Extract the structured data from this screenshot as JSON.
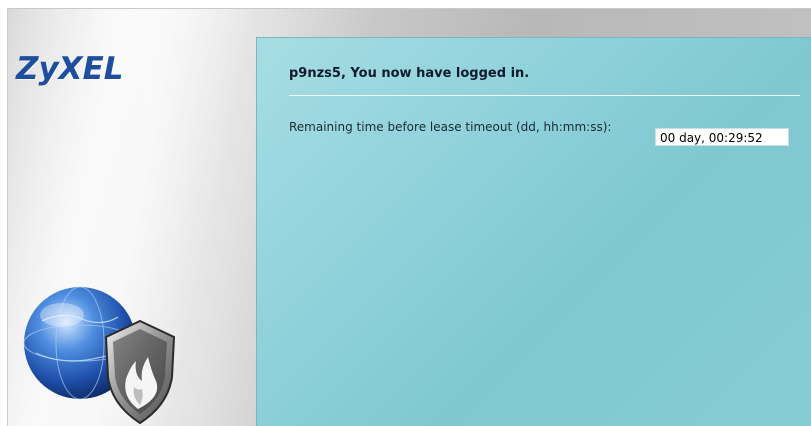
{
  "brand": {
    "logo_text": "ZyXEL"
  },
  "panel": {
    "title": "p9nzs5, You now have logged in.",
    "lease_label": "Remaining time before lease timeout (dd, hh:mm:ss):",
    "lease_value": "00 day, 00:29:52"
  },
  "colors": {
    "brand_blue": "#1e4f9e",
    "panel_teal": "#8fd1da"
  },
  "icons": [
    "globe-icon",
    "shield-flame-icon"
  ]
}
